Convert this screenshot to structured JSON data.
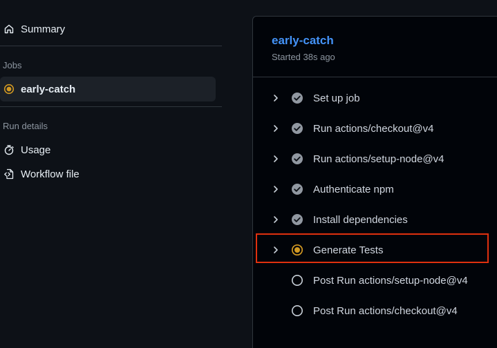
{
  "sidebar": {
    "summary_label": "Summary",
    "jobs_heading": "Jobs",
    "job_label": "early-catch",
    "run_details_heading": "Run details",
    "usage_label": "Usage",
    "workflow_file_label": "Workflow file"
  },
  "job_panel": {
    "title": "early-catch",
    "subtitle": "Started 38s ago",
    "steps": [
      {
        "label": "Set up job",
        "status": "success",
        "expandable": true
      },
      {
        "label": "Run actions/checkout@v4",
        "status": "success",
        "expandable": true
      },
      {
        "label": "Run actions/setup-node@v4",
        "status": "success",
        "expandable": true
      },
      {
        "label": "Authenticate npm",
        "status": "success",
        "expandable": true
      },
      {
        "label": "Install dependencies",
        "status": "success",
        "expandable": true
      },
      {
        "label": "Generate Tests",
        "status": "in_progress",
        "expandable": true
      },
      {
        "label": "Post Run actions/setup-node@v4",
        "status": "pending",
        "expandable": false
      },
      {
        "label": "Post Run actions/checkout@v4",
        "status": "pending",
        "expandable": false
      }
    ]
  },
  "colors": {
    "background": "#0d1117",
    "panel_background": "#010409",
    "link_blue": "#4493f8",
    "in_progress_yellow": "#d29922",
    "success_gray": "#9198a1",
    "highlight_red": "#e0300e"
  },
  "icons": {
    "summary": "home-icon",
    "job": "in-progress-icon",
    "usage": "stopwatch-icon",
    "workflow_file": "file-code-icon",
    "expand": "chevron-right-icon",
    "success": "check-circle-icon",
    "in_progress": "in-progress-icon",
    "pending": "circle-icon"
  }
}
